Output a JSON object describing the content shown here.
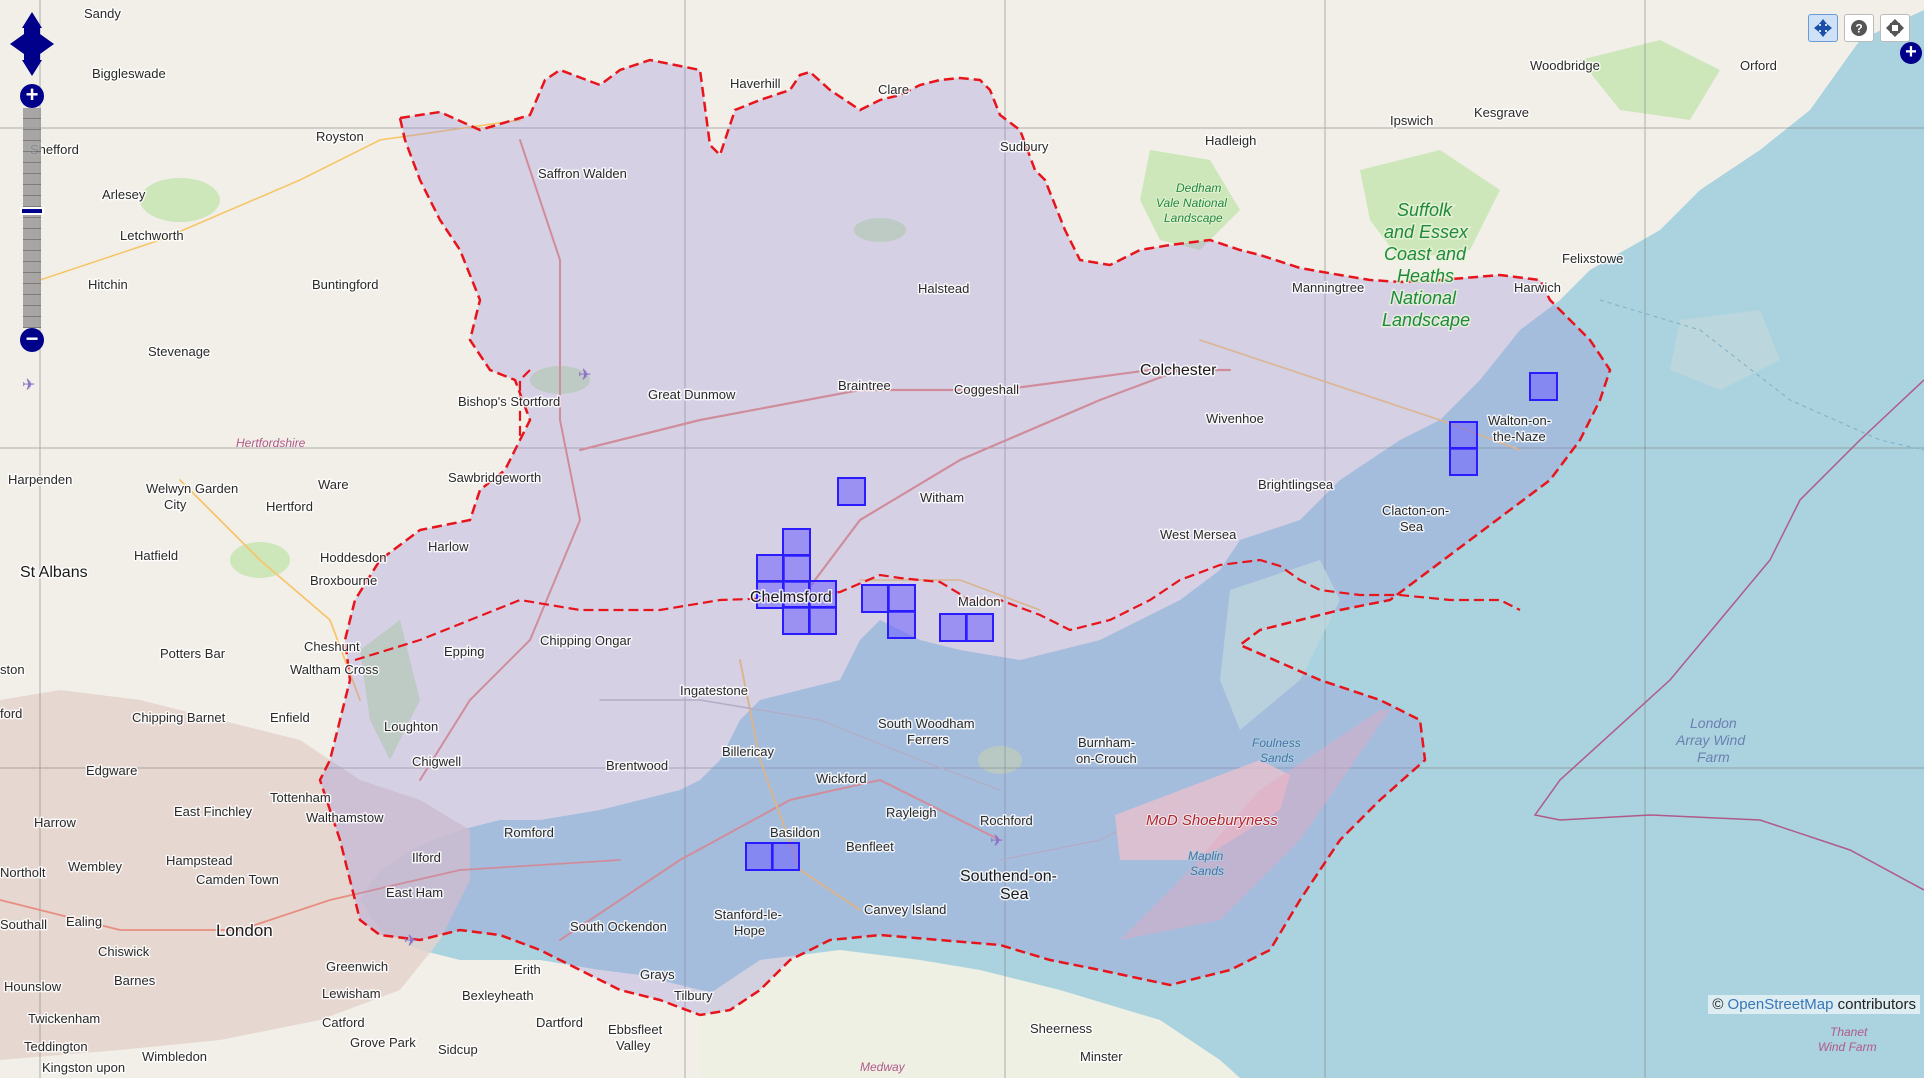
{
  "map": {
    "colors": {
      "sea": "#aad3df",
      "land": "#f2efe9",
      "boundary": "#e8141b",
      "region_fill": "#9b8fd9",
      "grid_square": "#2b1bff"
    },
    "labels": {
      "sandy": "Sandy",
      "biggleswade": "Biggleswade",
      "haverhill": "Haverhill",
      "clare": "Clare",
      "woodbridge": "Woodbridge",
      "orford": "Orford",
      "royston": "Royston",
      "shefford": "Shefford",
      "saffron_walden": "Saffron Walden",
      "sudbury": "Sudbury",
      "ipswich": "Ipswich",
      "kesgrave": "Kesgrave",
      "hadleigh": "Hadleigh",
      "arlesey": "Arlesey",
      "letchworth": "Letchworth",
      "hitchin": "Hitchin",
      "buntingford": "Buntingford",
      "halstead": "Halstead",
      "manningtree": "Manningtree",
      "harwich": "Harwich",
      "felixstowe": "Felixstowe",
      "stevenage": "Stevenage",
      "colchester": "Colchester",
      "great_dunmow": "Great Dunmow",
      "braintree": "Braintree",
      "coggeshall": "Coggeshall",
      "bishops_stortford": "Bishop's Stortford",
      "wivenhoe": "Wivenhoe",
      "walton_1": "Walton-on-",
      "walton_2": "the-Naze",
      "hertfordshire": "Hertfordshire",
      "harpenden": "Harpenden",
      "sawbridgeworth": "Sawbridgeworth",
      "ware": "Ware",
      "welwyn_1": "Welwyn Garden",
      "welwyn_2": "City",
      "witham": "Witham",
      "brightlingsea": "Brightlingsea",
      "hertford": "Hertford",
      "clacton_1": "Clacton-on-",
      "clacton_2": "Sea",
      "west_mersea": "West Mersea",
      "harlow": "Harlow",
      "hatfield": "Hatfield",
      "hoddesdon": "Hoddesdon",
      "st_albans": "St Albans",
      "broxbourne": "Broxbourne",
      "chelmsford": "Chelmsford",
      "maldon": "Maldon",
      "chipping_ongar": "Chipping Ongar",
      "potters_bar": "Potters Bar",
      "epping": "Epping",
      "cheshunt": "Cheshunt",
      "waltham_cross": "Waltham Cross",
      "ingatestone": "Ingatestone",
      "ston": "ston",
      "ford": "ford",
      "chipping_barnet": "Chipping Barnet",
      "enfield": "Enfield",
      "loughton": "Loughton",
      "swf_1": "South Woodham",
      "swf_2": "Ferrers",
      "billericay": "Billericay",
      "burnham_1": "Burnham-",
      "burnham_2": "on-Crouch",
      "foulness_1": "Foulness",
      "foulness_2": "Sands",
      "chigwell": "Chigwell",
      "edgware": "Edgware",
      "brentwood": "Brentwood",
      "wickford": "Wickford",
      "tottenham": "Tottenham",
      "east_finchley": "East Finchley",
      "harrow": "Harrow",
      "walthamstow": "Walthamstow",
      "rayleigh": "Rayleigh",
      "rochford": "Rochford",
      "mod_shoeburyness": "MoD Shoeburyness",
      "romford": "Romford",
      "basildon": "Basildon",
      "benfleet": "Benfleet",
      "hampstead": "Hampstead",
      "wembley": "Wembley",
      "ilford": "Ilford",
      "camden_town": "Camden Town",
      "northolt": "Northolt",
      "maplin_1": "Maplin",
      "maplin_2": "Sands",
      "southend_1": "Southend-on-",
      "southend_2": "Sea",
      "east_ham": "East Ham",
      "london": "London",
      "southall": "Southall",
      "ealing": "Ealing",
      "south_ockendon": "South Ockendon",
      "canvey": "Canvey Island",
      "chiswick": "Chiswick",
      "stanford_1": "Stanford-le-",
      "stanford_2": "Hope",
      "greenwich": "Greenwich",
      "erith": "Erith",
      "barnes": "Barnes",
      "grays": "Grays",
      "hounslow": "Hounslow",
      "lewisham": "Lewisham",
      "bexleyheath": "Bexleyheath",
      "tilbury": "Tilbury",
      "twickenham": "Twickenham",
      "catford": "Catford",
      "dartford": "Dartford",
      "ebbsfleet_1": "Ebbsfleet",
      "ebbsfleet_2": "Valley",
      "sheerness": "Sheerness",
      "teddington": "Teddington",
      "grove_park": "Grove Park",
      "sidcup": "Sidcup",
      "wimbledon": "Wimbledon",
      "kingston": "Kingston upon",
      "medway": "Medway",
      "minster": "Minster",
      "london_array_1": "London",
      "london_array_2": "Array Wind",
      "london_array_3": "Farm",
      "thanet_1": "Thanet",
      "thanet_2": "Wind Farm",
      "suffolk_1": "Suffolk",
      "suffolk_2": "and Essex",
      "suffolk_3": "Coast and",
      "suffolk_4": "Heaths",
      "suffolk_5": "National",
      "suffolk_6": "Landscape",
      "dedham_1": "Dedham",
      "dedham_2": "Vale National",
      "dedham_3": "Landscape"
    }
  },
  "controls": {
    "pan_icon": "pan-arrows-icon",
    "zoom_in": "+",
    "zoom_out": "−",
    "zoom_level_fraction": 0.47,
    "tools": [
      {
        "name": "pan-tool-icon",
        "active": true
      },
      {
        "name": "query-tool-icon",
        "active": false
      },
      {
        "name": "zoom-extent-icon",
        "active": false
      }
    ],
    "layer_switcher": "+"
  },
  "attribution": {
    "prefix": "© ",
    "link": "OpenStreetMap",
    "suffix": " contributors"
  }
}
